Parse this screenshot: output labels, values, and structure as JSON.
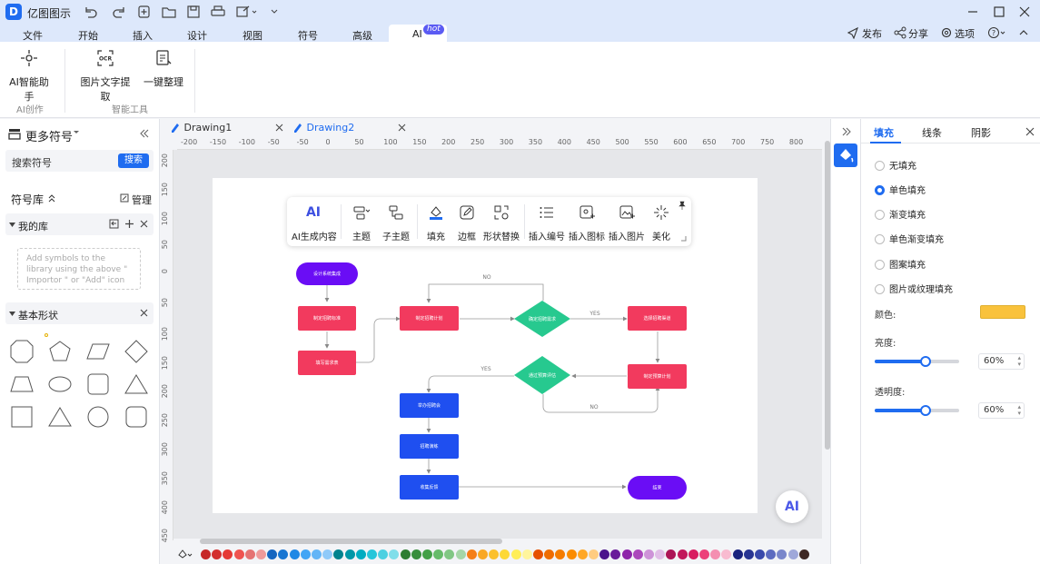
{
  "app": {
    "title": "亿图图示",
    "logo": "D"
  },
  "menu": {
    "items": [
      "文件",
      "开始",
      "插入",
      "设计",
      "视图",
      "符号",
      "高级",
      "AI"
    ],
    "hot_badge": "hot",
    "active": "AI"
  },
  "top_actions": {
    "publish": "发布",
    "share": "分享",
    "options": "选项",
    "help": "?"
  },
  "ribbon": {
    "ai_assistant": "AI智能助手",
    "ocr": "图片文字提取",
    "auto_arrange": "一键整理",
    "group_ai": "AI创作",
    "group_tools": "智能工具"
  },
  "left_panel": {
    "title": "更多符号",
    "search_label": "搜索符号",
    "search_button": "搜索",
    "library_label": "符号库",
    "manage": "管理",
    "my_library": "我的库",
    "drop_hint": "Add symbols to the library using the above \" Importor \" or \"Add\" icon",
    "basic_shapes": "基本形状"
  },
  "doc_tabs": [
    "Drawing1",
    "Drawing2"
  ],
  "active_tab": "Drawing2",
  "ruler_h": [
    "-200",
    "-150",
    "-100",
    "-50",
    "-50",
    "0",
    "50",
    "100",
    "150",
    "200",
    "250",
    "300",
    "350",
    "400",
    "450",
    "500",
    "550",
    "600",
    "650",
    "700",
    "750",
    "800"
  ],
  "ruler_v": [
    "200",
    "150",
    "100",
    "50",
    "0",
    "50",
    "100",
    "150",
    "200",
    "250",
    "300",
    "350",
    "400",
    "450"
  ],
  "floating_toolbar": {
    "ai_label": "AI",
    "ai_generate": "AI生成内容",
    "theme": "主题",
    "subtheme": "子主题",
    "fill": "填充",
    "border": "边框",
    "shape_replace": "形状替换",
    "insert_number": "插入编号",
    "insert_icon": "插入图标",
    "insert_image": "插入图片",
    "beautify": "美化"
  },
  "flowchart": {
    "nodes": {
      "start": "设计系统集成",
      "n1": "制定招聘标准",
      "n2": "填写需求表",
      "n3": "制定招聘计划",
      "d1": "确定招聘需求",
      "n4": "选择招聘渠道",
      "d2": "通过预算评估",
      "n5": "制定预算计划",
      "n6": "举办招聘会",
      "n7": "招聘演练",
      "n8": "收集反馈",
      "end": "结束"
    },
    "labels": {
      "no_top": "NO",
      "yes_right": "YES",
      "yes_left": "YES",
      "no_bottom": "NO"
    }
  },
  "ai_badge": "AI",
  "colors": {
    "accent": "#1f6cf0",
    "node_pink": "#f23a5e",
    "node_blue": "#1f4ff0",
    "node_purple": "#6a0df5",
    "decision_green": "#27c98f",
    "fill_color": "#f9c23c",
    "palette": [
      "#c62828",
      "#d32f2f",
      "#e53935",
      "#ef5350",
      "#e57373",
      "#ef9a9a",
      "#1565c0",
      "#1976d2",
      "#1e88e5",
      "#42a5f5",
      "#64b5f6",
      "#90caf9",
      "#00838f",
      "#0097a7",
      "#00acc1",
      "#26c6da",
      "#4dd0e1",
      "#80deea",
      "#2e7d32",
      "#388e3c",
      "#43a047",
      "#66bb6a",
      "#81c784",
      "#a5d6a7",
      "#f57f17",
      "#f9a825",
      "#fbc02d",
      "#fdd835",
      "#ffee58",
      "#fff59d",
      "#e65100",
      "#ef6c00",
      "#f57c00",
      "#fb8c00",
      "#ffa726",
      "#ffcc80",
      "#4a148c",
      "#6a1b9a",
      "#8e24aa",
      "#ab47bc",
      "#ce93d8",
      "#e1bee7",
      "#ad1457",
      "#c2185b",
      "#d81b60",
      "#ec407a",
      "#f48fb1",
      "#f8bbd0",
      "#1a237e",
      "#283593",
      "#3949ab",
      "#5c6bc0",
      "#7986cb",
      "#9fa8da",
      "#3e2723"
    ]
  },
  "right_panel": {
    "tabs": [
      "填充",
      "线条",
      "阴影"
    ],
    "options": [
      "无填充",
      "单色填充",
      "渐变填充",
      "单色渐变填充",
      "图案填充",
      "图片或纹理填充"
    ],
    "selected_option": "单色填充",
    "color_label": "颜色:",
    "brightness_label": "亮度:",
    "brightness_value": "60%",
    "brightness": 0.6,
    "opacity_label": "透明度:",
    "opacity_value": "60%",
    "opacity": 0.6
  }
}
